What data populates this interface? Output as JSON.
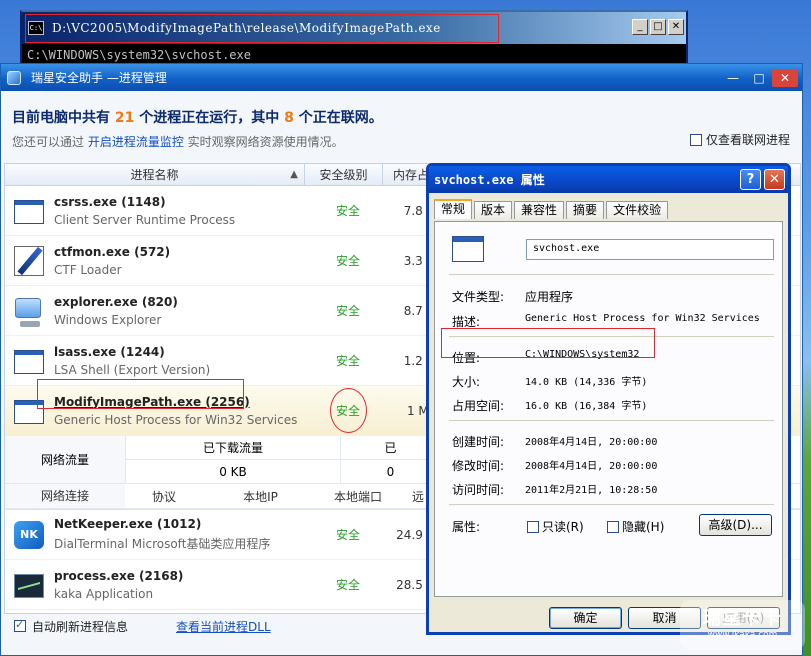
{
  "console": {
    "icon_text": "C:\\",
    "title": "D:\\VC2005\\ModifyImagePath\\release\\ModifyImagePath.exe",
    "buttons": {
      "minimize": "_",
      "maximize": "□",
      "close": "✕"
    },
    "output_line": "C:\\WINDOWS\\system32\\svchost.exe"
  },
  "main": {
    "title": "瑞星安全助手 —进程管理",
    "window_controls": {
      "minimize": "—",
      "restore": "□",
      "close": "✕"
    },
    "summary": {
      "prefix": "目前电脑中共有 ",
      "process_count": "21",
      "middle": " 个进程正在运行，其中 ",
      "network_count": "8",
      "suffix": " 个正在联网。"
    },
    "hint": {
      "prefix": "您还可以通过 ",
      "link": "开启进程流量监控",
      "suffix": " 实时观察网络资源使用情况。"
    },
    "network_only_label": "仅查看联网进程",
    "columns": {
      "name": "进程名称",
      "safety": "安全级别",
      "memory": "内存占"
    },
    "processes": [
      {
        "name": "csrss.exe (1148)",
        "desc": "Client Server Runtime Process",
        "safety": "安全",
        "mem": "7.8 M",
        "icon": "window-icon"
      },
      {
        "name": "ctfmon.exe (572)",
        "desc": "CTF Loader",
        "safety": "安全",
        "mem": "3.3 M",
        "icon": "pen-icon"
      },
      {
        "name": "explorer.exe (820)",
        "desc": "Windows Explorer",
        "safety": "安全",
        "mem": "8.7 M",
        "icon": "computer-icon"
      },
      {
        "name": "lsass.exe (1244)",
        "desc": "LSA Shell (Export Version)",
        "safety": "安全",
        "mem": "1.2 M",
        "icon": "window-icon"
      },
      {
        "name": "ModifyImagePath.exe (2256)",
        "desc": "Generic Host Process for Win32 Services",
        "safety": "安全",
        "mem": "1 MB",
        "icon": "window-icon"
      }
    ],
    "detail": {
      "traffic_label": "网络流量",
      "download_label": "已下载流量",
      "download_value": "0 KB",
      "upload_label": "已",
      "upload_value": "0",
      "conn_label": "网络连接",
      "conn_cols": [
        "协议",
        "本地IP",
        "本地端口",
        "远"
      ]
    },
    "processes_after": [
      {
        "name": "NetKeeper.exe (1012)",
        "desc": "DialTerminal Microsoft基础类应用程序",
        "safety": "安全",
        "mem": "24.9 M",
        "icon": "netkeeper-icon"
      },
      {
        "name": "process.exe (2168)",
        "desc": "kaka Application",
        "safety": "安全",
        "mem": "28.5 M",
        "icon": "graph-icon"
      }
    ],
    "footer": {
      "auto_refresh_label": "自动刷新进程信息",
      "auto_refresh_checked": true,
      "dll_link": "查看当前进程DLL"
    }
  },
  "props": {
    "title": "svchost.exe 属性",
    "help": "?",
    "close": "✕",
    "tabs": [
      "常规",
      "版本",
      "兼容性",
      "摘要",
      "文件校验"
    ],
    "active_tab": 0,
    "file_name": "svchost.exe",
    "fields": {
      "type_label": "文件类型:",
      "type_value": "应用程序",
      "desc_label": "描述:",
      "desc_value": "Generic Host Process for Win32 Services",
      "location_label": "位置:",
      "location_value": "C:\\WINDOWS\\system32",
      "size_label": "大小:",
      "size_value": "14.0 KB (14,336 字节)",
      "disk_label": "占用空间:",
      "disk_value": "16.0 KB (16,384 字节)",
      "created_label": "创建时间:",
      "created_value": "2008年4月14日, 20:00:00",
      "modified_label": "修改时间:",
      "modified_value": "2008年4月14日, 20:00:00",
      "accessed_label": "访问时间:",
      "accessed_value": "2011年2月21日, 10:28:50",
      "attr_label": "属性:",
      "readonly_label": "只读(R)",
      "hidden_label": "隐藏(H)",
      "advanced_label": "高级(D)..."
    },
    "ok_label": "确定",
    "cancel_label": "取消",
    "apply_label": "应用(A)"
  },
  "watermark": {
    "line1": "瑞星卡卡",
    "line2": "www.ikaka.com"
  },
  "colors": {
    "highlight_red": "#e0262f",
    "safe_green": "#27a02a",
    "count_orange": "#f07b12"
  }
}
